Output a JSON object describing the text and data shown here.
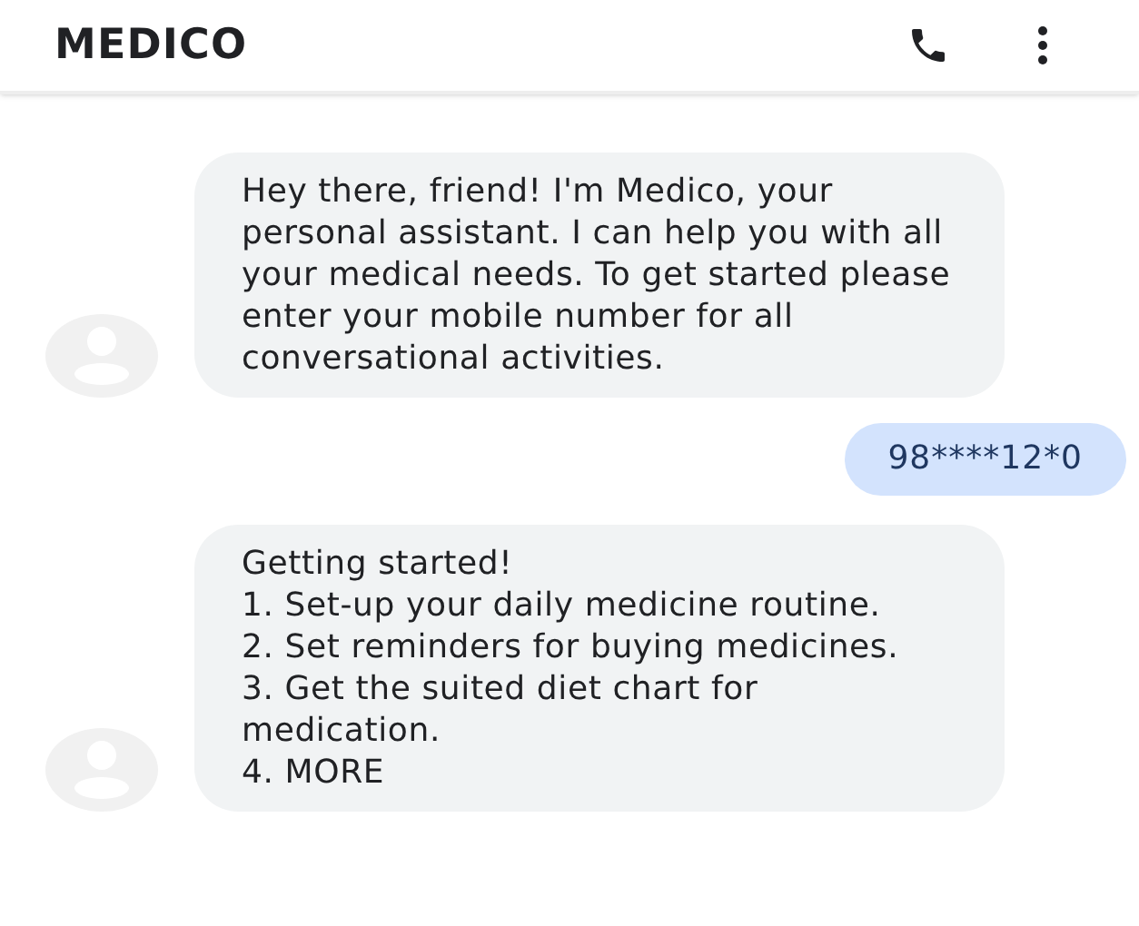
{
  "header": {
    "title": "MEDICO"
  },
  "messages": [
    {
      "kind": "bot",
      "paragraphs": [
        "Hey there, friend! I'm Medico, your personal assistant. I can help you with all your medical needs. To get started please enter your mobile number for all conversational activities."
      ]
    },
    {
      "kind": "user",
      "paragraphs": [
        "98****12*0"
      ]
    },
    {
      "kind": "bot",
      "paragraphs": [
        "Getting started!",
        "1. Set-up your daily medicine routine.",
        "2. Set reminders for buying medicines.",
        "3. Get the suited diet chart for medication.",
        "4. MORE"
      ]
    }
  ]
}
